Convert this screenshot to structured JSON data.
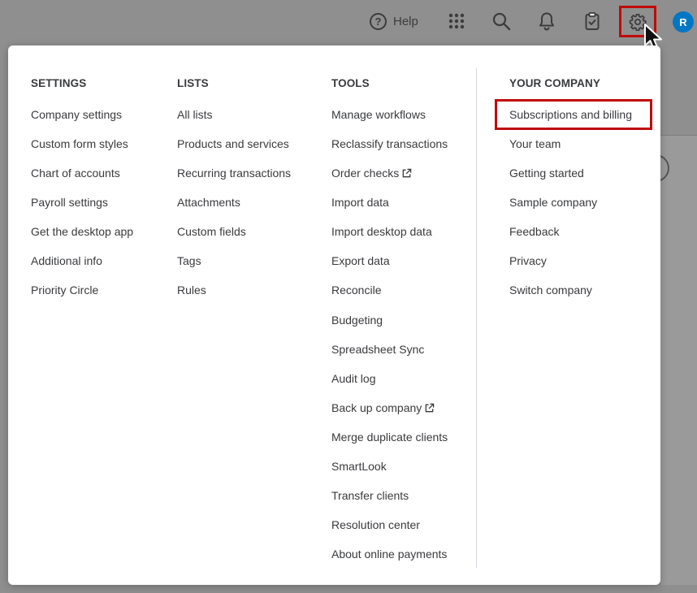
{
  "topbar": {
    "help_label": "Help",
    "help_glyph": "?",
    "avatar_initial": "R",
    "accent_color": "#0077c5",
    "highlight_color": "#c00a0a"
  },
  "menu": {
    "settings": {
      "heading": "SETTINGS",
      "items": [
        "Company settings",
        "Custom form styles",
        "Chart of accounts",
        "Payroll settings",
        "Get the desktop app",
        "Additional info",
        "Priority Circle"
      ]
    },
    "lists": {
      "heading": "LISTS",
      "items": [
        "All lists",
        "Products and services",
        "Recurring transactions",
        "Attachments",
        "Custom fields",
        "Tags",
        "Rules"
      ]
    },
    "tools": {
      "heading": "TOOLS",
      "items": [
        "Manage workflows",
        "Reclassify transactions",
        "Order checks",
        "Import data",
        "Import desktop data",
        "Export data",
        "Reconcile",
        "Budgeting",
        "Spreadsheet Sync",
        "Audit log",
        "Back up company",
        "Merge duplicate clients",
        "SmartLook",
        "Transfer clients",
        "Resolution center",
        "About online payments"
      ]
    },
    "company": {
      "heading": "YOUR COMPANY",
      "items": [
        "Subscriptions and billing",
        "Your team",
        "Getting started",
        "Sample company",
        "Feedback",
        "Privacy",
        "Switch company"
      ]
    }
  }
}
